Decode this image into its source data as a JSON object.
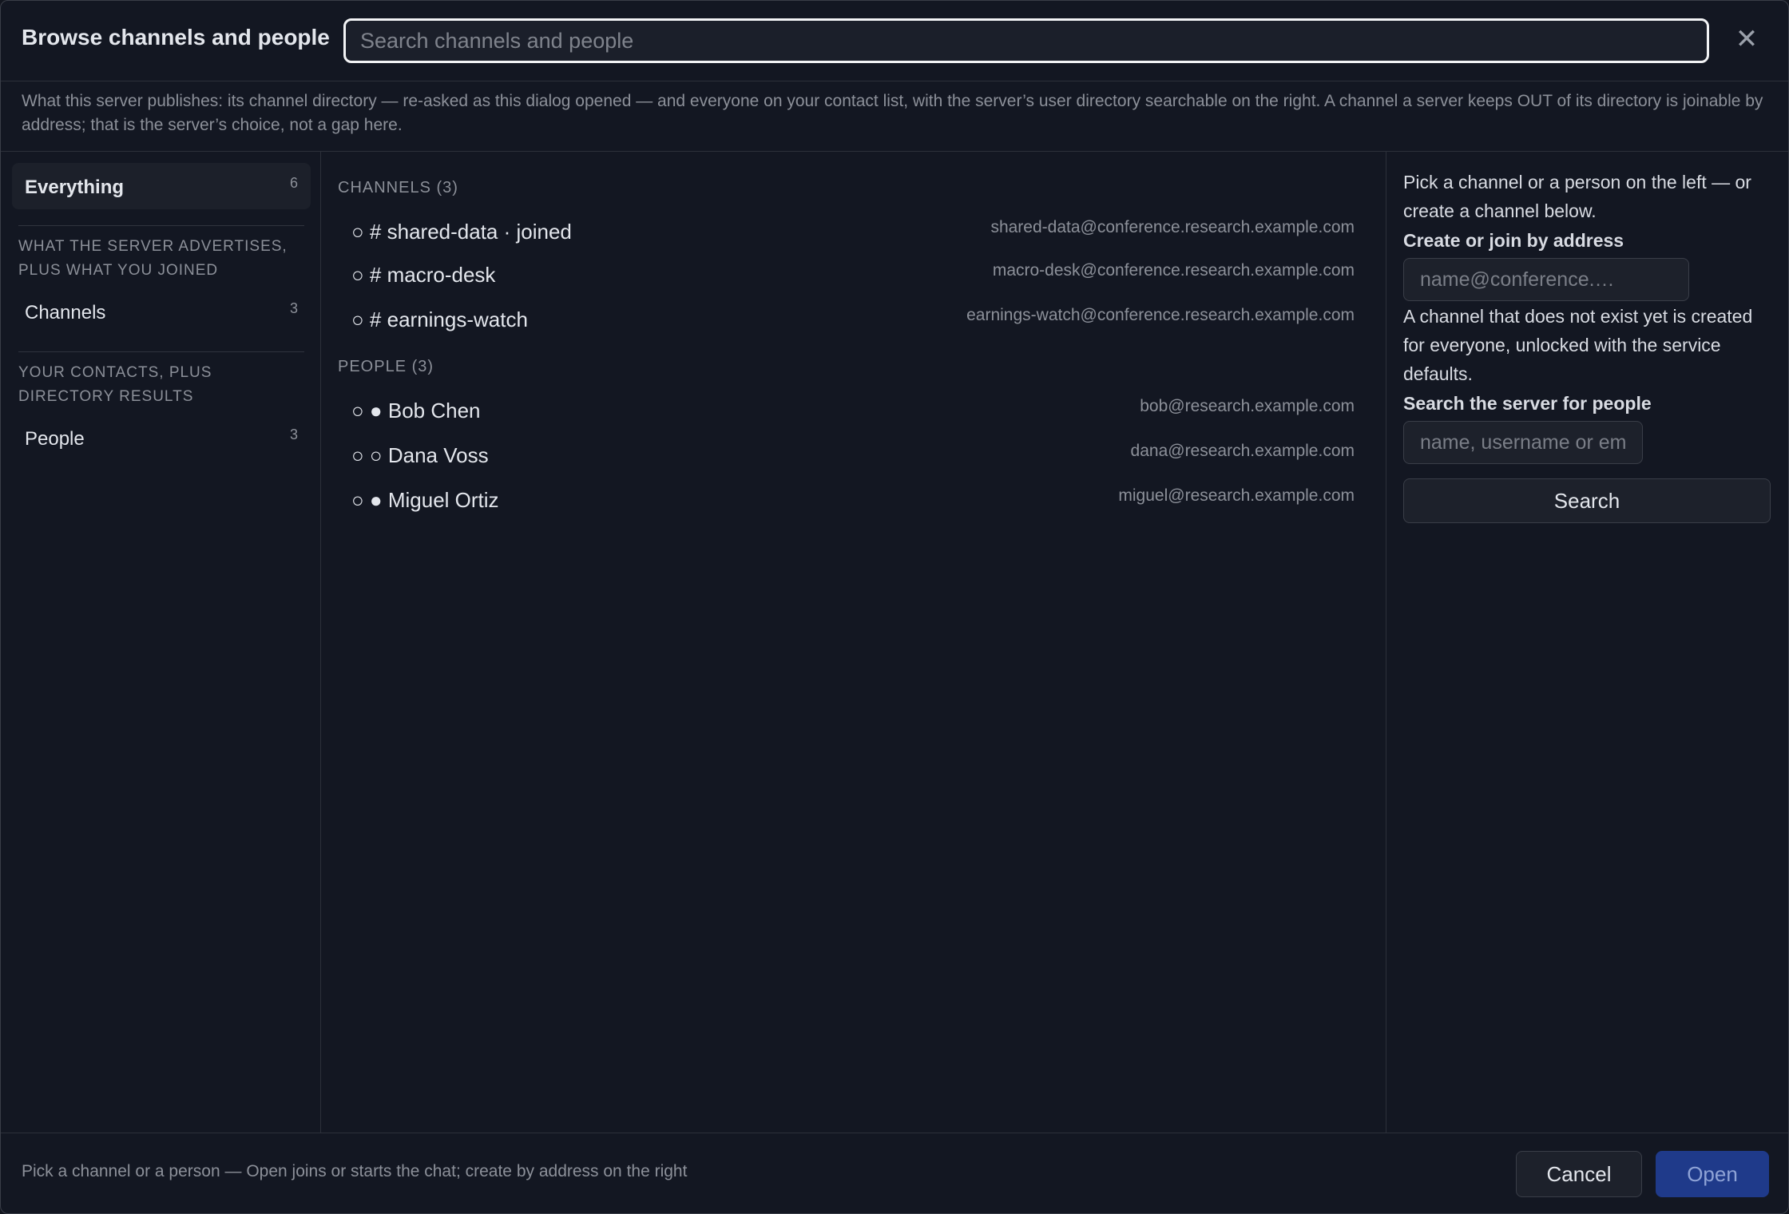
{
  "header": {
    "title": "Browse channels and people",
    "search_placeholder": "Search channels and people",
    "close_glyph": "✕"
  },
  "description": "What this server publishes: its channel directory — re-asked as this dialog opened — and everyone on your contact list, with the server’s user directory searchable on the right. A channel a server keeps OUT of its directory is joinable by address; that is the server’s choice, not a gap here.",
  "sidebar": {
    "everything": {
      "label": "Everything",
      "count": "6"
    },
    "channels_heading": "WHAT THE SERVER ADVERTISES, PLUS WHAT YOU JOINED",
    "channels": {
      "label": "Channels",
      "count": "3"
    },
    "people_heading": "YOUR CONTACTS, PLUS DIRECTORY RESULTS",
    "people": {
      "label": "People",
      "count": "3"
    }
  },
  "list": {
    "channels_heading": "CHANNELS (3)",
    "channels": [
      {
        "name": "○  #  shared-data · joined",
        "address": "shared-data@conference.research.example.com"
      },
      {
        "name": "○  #  macro-desk",
        "address": "macro-desk@conference.research.example.com"
      },
      {
        "name": "○  #  earnings-watch",
        "address": "earnings-watch@conference.research.example.com"
      }
    ],
    "people_heading": "PEOPLE (3)",
    "people": [
      {
        "name": "○ ● Bob Chen",
        "address": "bob@research.example.com"
      },
      {
        "name": "○ ○ Dana Voss",
        "address": "dana@research.example.com"
      },
      {
        "name": "○ ● Miguel Ortiz",
        "address": "miguel@research.example.com"
      }
    ]
  },
  "right_panel": {
    "intro": "Pick a channel or a person on the left — or create a channel below.",
    "create_heading": "Create or join by address",
    "create_placeholder": "name@conference.…",
    "create_note": "A channel that does not exist yet is created for everyone, unlocked with the service defaults.",
    "search_heading": "Search the server for people",
    "search_placeholder": "name, username or email",
    "search_button": "Search"
  },
  "footer": {
    "hint": "Pick a channel or a person — Open joins or starts the chat; create by address on the right",
    "cancel_label": "Cancel",
    "open_label": "Open"
  }
}
